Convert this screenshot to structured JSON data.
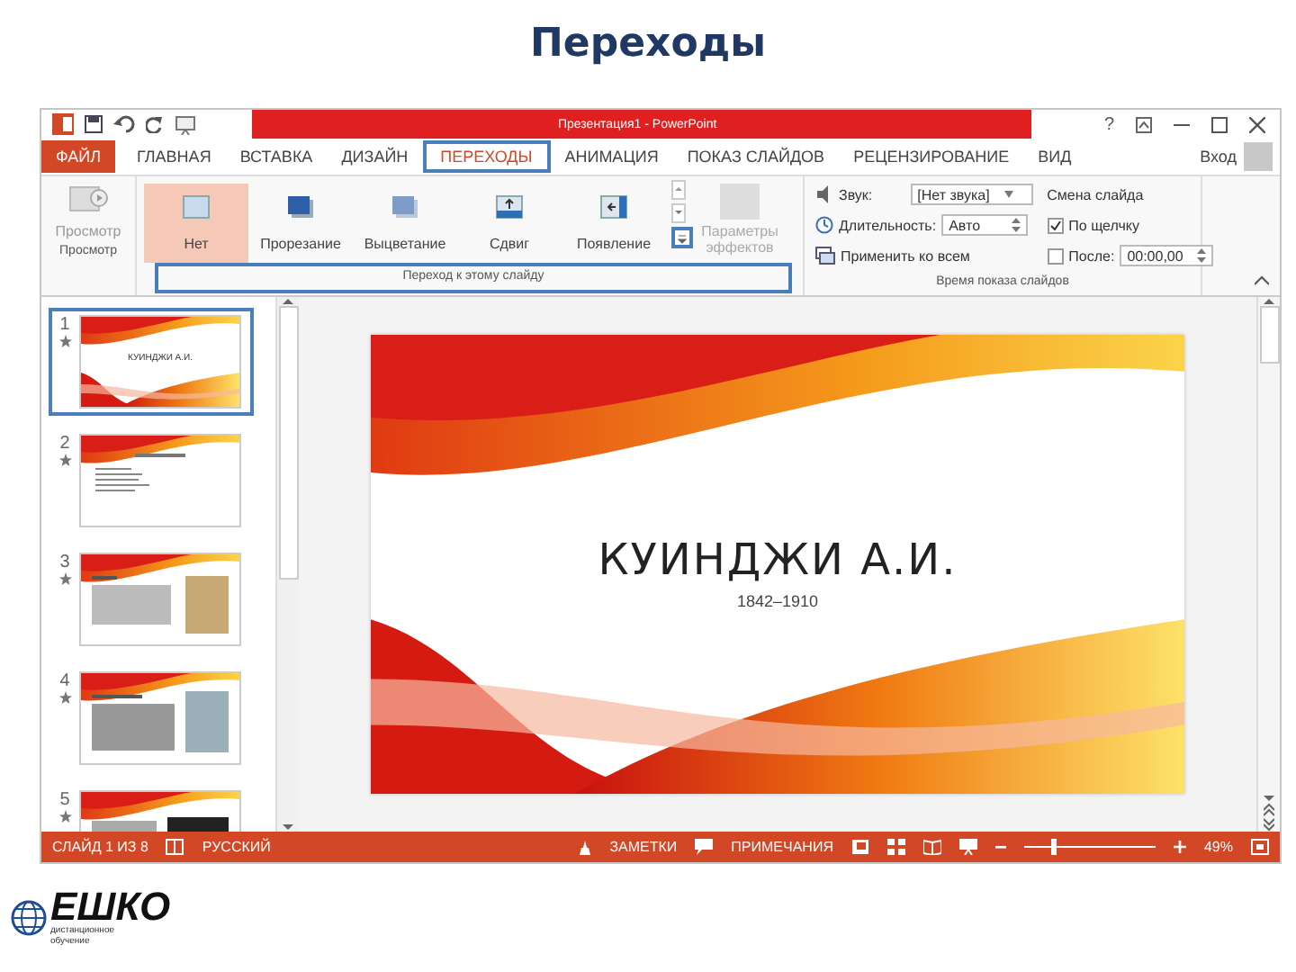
{
  "slide_title": "Переходы",
  "window": {
    "title": "Презентация1 - PowerPoint",
    "help": "?"
  },
  "tabs": [
    {
      "label": "ФАЙЛ",
      "kind": "file",
      "selected": false,
      "highlighted": false
    },
    {
      "label": "ГЛАВНАЯ",
      "kind": "tab",
      "selected": false,
      "highlighted": false
    },
    {
      "label": "ВСТАВКА",
      "kind": "tab",
      "selected": false,
      "highlighted": false
    },
    {
      "label": "ДИЗАЙН",
      "kind": "tab",
      "selected": false,
      "highlighted": false
    },
    {
      "label": "ПЕРЕХОДЫ",
      "kind": "tab",
      "selected": true,
      "highlighted": true
    },
    {
      "label": "АНИМАЦИЯ",
      "kind": "tab",
      "selected": false,
      "highlighted": false
    },
    {
      "label": "ПОКАЗ СЛАЙДОВ",
      "kind": "tab",
      "selected": false,
      "highlighted": false
    },
    {
      "label": "РЕЦЕНЗИРОВАНИЕ",
      "kind": "tab",
      "selected": false,
      "highlighted": false
    },
    {
      "label": "ВИД",
      "kind": "tab",
      "selected": false,
      "highlighted": false
    }
  ],
  "signin": "Вход",
  "ribbon": {
    "preview": {
      "label": "Просмотр",
      "group": "Просмотр"
    },
    "transitions": [
      {
        "label": "Нет",
        "kind": "none",
        "selected": true
      },
      {
        "label": "Прорезание",
        "kind": "cut",
        "selected": false
      },
      {
        "label": "Выцветание",
        "kind": "fade",
        "selected": false
      },
      {
        "label": "Сдвиг",
        "kind": "push",
        "selected": false
      },
      {
        "label": "Появление",
        "kind": "wipe",
        "selected": false
      }
    ],
    "more_highlighted": true,
    "effects": "Параметры эффектов",
    "group": "Переход к этому слайду",
    "group_highlighted": true,
    "timing": {
      "sound_label": "Звук:",
      "sound_value": "[Нет звука]",
      "duration_label": "Длительность:",
      "duration_value": "Авто",
      "apply_all": "Применить ко всем",
      "advance_title": "Смена слайда",
      "on_click": {
        "label": "По щелчку",
        "checked": true
      },
      "after": {
        "label": "После:",
        "checked": false,
        "value": "00:00,00"
      },
      "group": "Время показа слайдов"
    }
  },
  "thumbnails": [
    {
      "number": "1",
      "kind": "title",
      "title": "КУИНДЖИ А.И.",
      "selected": true
    },
    {
      "number": "2",
      "kind": "list",
      "selected": false
    },
    {
      "number": "3",
      "kind": "portrait",
      "selected": false
    },
    {
      "number": "4",
      "kind": "landscape",
      "selected": false
    },
    {
      "number": "5",
      "kind": "dark",
      "selected": false
    }
  ],
  "slide": {
    "title": "КУИНДЖИ А.И.",
    "subtitle": "1842–1910"
  },
  "status_bar": {
    "slide": "СЛАЙД 1 ИЗ 8",
    "language": "РУССКИЙ",
    "notes": "ЗАМЕТКИ",
    "comments": "ПРИМЕЧАНИЯ",
    "zoom": "49%",
    "zoom_slider": {
      "level": 0.22
    }
  },
  "logo": {
    "name": "ЕШКО",
    "tagline": "дистанционное обучение"
  }
}
